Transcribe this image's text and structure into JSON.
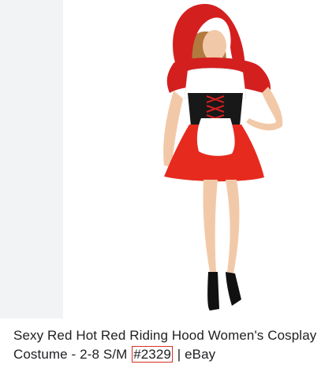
{
  "result": {
    "title_line1": "Sexy Red Hot Red Riding Hood Women's Cosplay",
    "title_line2_prefix": "Costume - 2-8 S/M ",
    "title_line2_highlight": "#2329",
    "title_line2_suffix": " | eBay",
    "image_icon": "product-photo-costume",
    "highlight_color": "#d93025",
    "panel_color": "#f1f3f4"
  }
}
